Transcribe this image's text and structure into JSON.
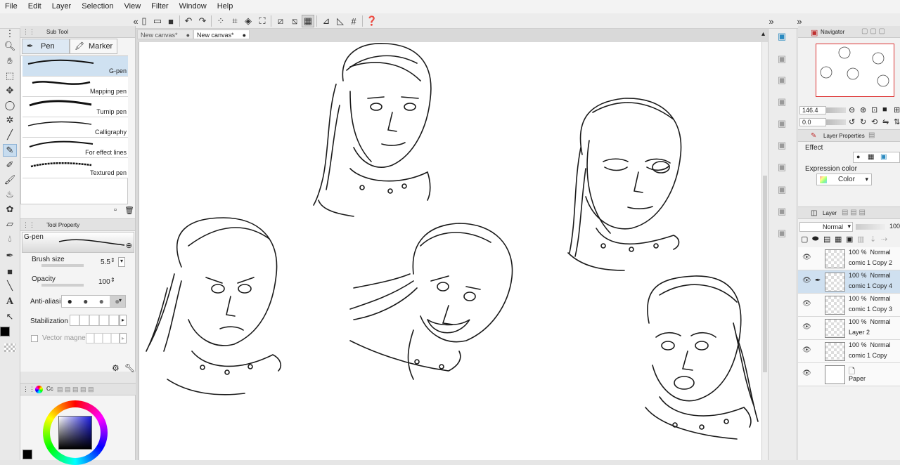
{
  "menu": [
    "File",
    "Edit",
    "Layer",
    "Selection",
    "View",
    "Filter",
    "Window",
    "Help"
  ],
  "canvas_tabs": [
    "New canvas*",
    "New canvas*"
  ],
  "subtool": {
    "title": "Sub Tool",
    "tabs": [
      "Pen",
      "Marker"
    ],
    "brushes": [
      "G-pen",
      "Mapping pen",
      "Turnip pen",
      "Calligraphy",
      "For effect lines",
      "Textured pen"
    ]
  },
  "tool_property": {
    "title": "Tool Property",
    "brush_name": "G-pen",
    "brush_size_label": "Brush size",
    "brush_size_value": "5.5",
    "opacity_label": "Opacity",
    "opacity_value": "100",
    "antialias_label": "Anti-aliasi",
    "stabilization_label": "Stabilization",
    "vector_magnet_label": "Vector magnet"
  },
  "color_panel": {
    "title": "Cc"
  },
  "navigator": {
    "title": "Navigator",
    "zoom": "146.4",
    "rotation": "0.0"
  },
  "layer_properties": {
    "title": "Layer Properties",
    "effect_label": "Effect",
    "expression_color_label": "Expression color",
    "expression_color_value": "Color"
  },
  "layer_panel": {
    "title": "Layer",
    "blend_mode": "Normal",
    "opacity": "100",
    "layers": [
      {
        "opacity": "100 %",
        "mode": "Normal",
        "name": "comic 1 Copy 2",
        "selected": false
      },
      {
        "opacity": "100 %",
        "mode": "Normal",
        "name": "comic 1 Copy 4",
        "selected": true
      },
      {
        "opacity": "100 %",
        "mode": "Normal",
        "name": "comic 1 Copy 3",
        "selected": false
      },
      {
        "opacity": "100 %",
        "mode": "Normal",
        "name": "Layer 2",
        "selected": false
      },
      {
        "opacity": "100 %",
        "mode": "Normal",
        "name": "comic 1 Copy",
        "selected": false
      },
      {
        "opacity": "",
        "mode": "",
        "name": "Paper",
        "selected": false
      }
    ]
  },
  "colors": {
    "selection_blue": "#cfe1f1",
    "main_color": "#000000"
  }
}
